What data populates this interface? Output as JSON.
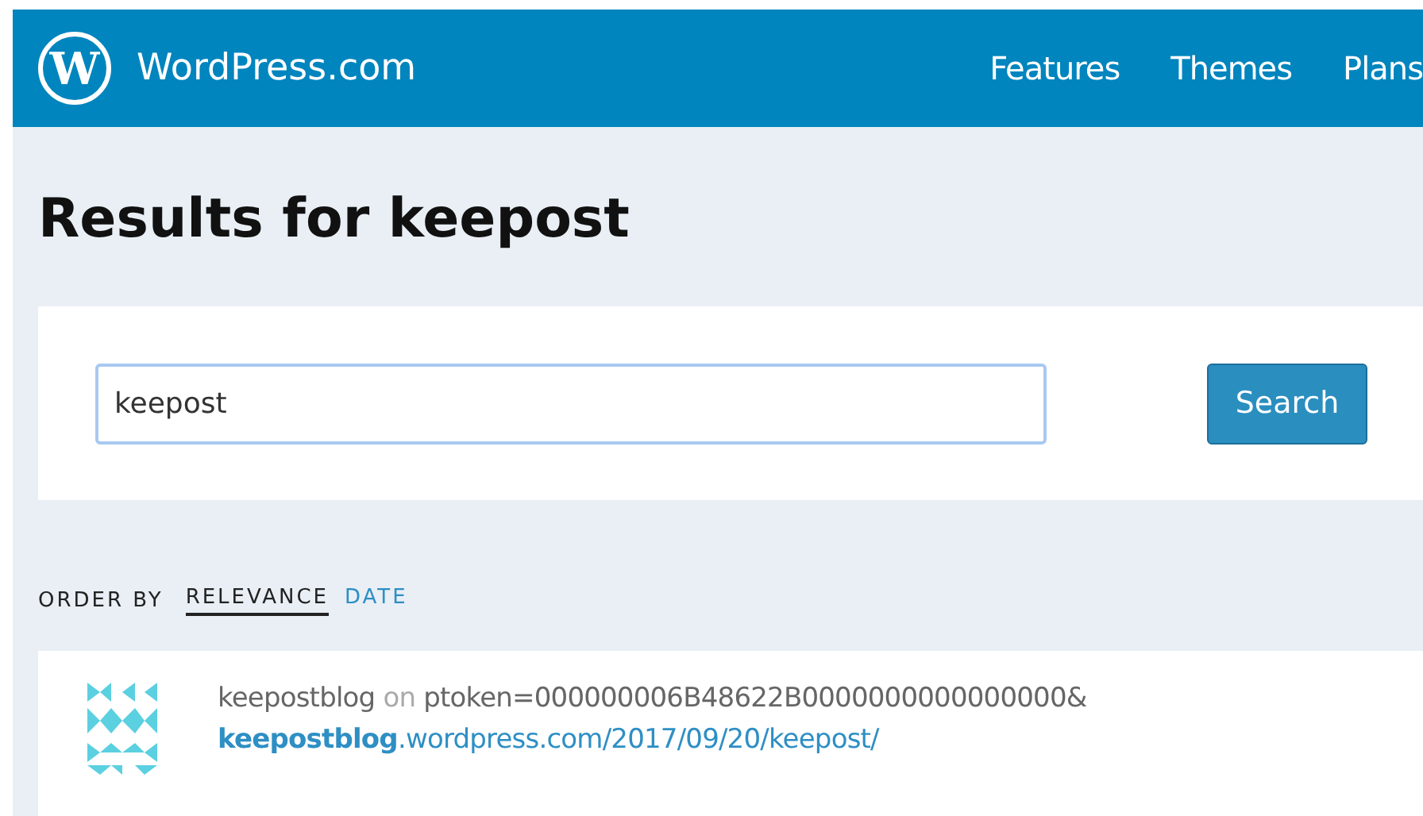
{
  "header": {
    "logo_mark": "W",
    "site_name": "WordPress.com",
    "nav": [
      {
        "label": "Features"
      },
      {
        "label": "Themes"
      },
      {
        "label": "Plans"
      }
    ]
  },
  "heading": "Results for keepost",
  "search": {
    "value": "keepost",
    "button": "Search"
  },
  "order_by": {
    "label": "ORDER BY",
    "options": [
      {
        "label": "RELEVANCE",
        "selected": true
      },
      {
        "label": "DATE",
        "selected": false
      }
    ]
  },
  "results": [
    {
      "blog": "keepostblog",
      "joiner": "on",
      "title": "ptoken=000000006B48622B0000000000000000&",
      "url": "**keepostblog**.wordpress.com/2017/09/20/keepost/"
    }
  ]
}
